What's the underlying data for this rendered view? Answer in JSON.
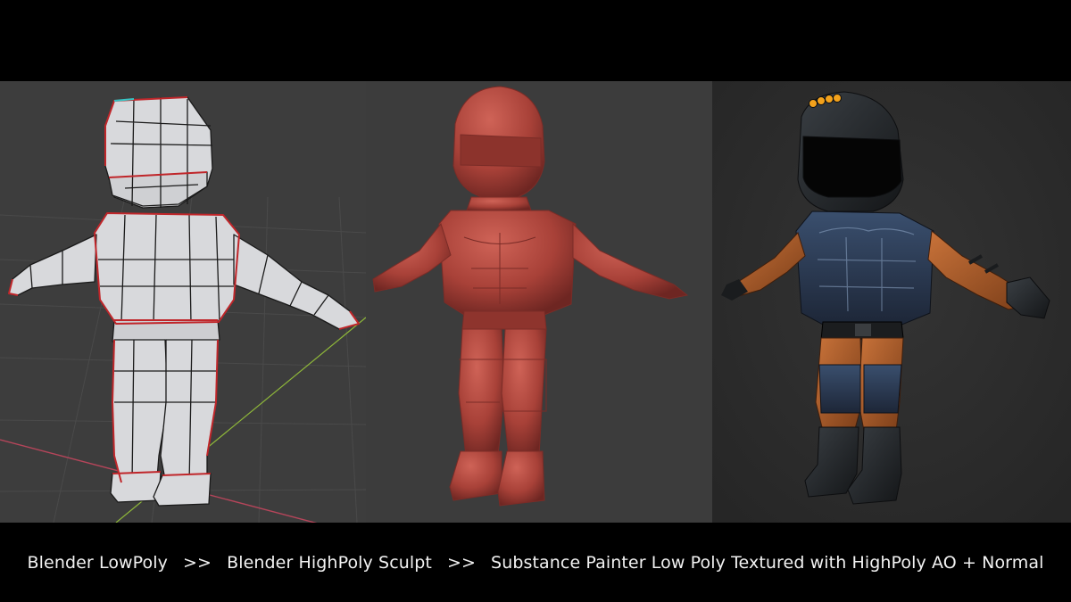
{
  "caption": {
    "step1": "Blender LowPoly",
    "sep1": ">>",
    "step2": "Blender HighPoly Sculpt",
    "sep2": ">>",
    "step3": "Substance Painter Low Poly Textured with HighPoly AO + Normal"
  },
  "colors": {
    "frame": "#000000",
    "viewport_bg": "#3f3f3f",
    "render_bg": "#2e2e2e",
    "lowpoly_mesh": "#d8d9dc",
    "lowpoly_wire": "#1a1a1a",
    "lowpoly_seam": "#c0262a",
    "sculpt_clay": "#b4483f",
    "textured_orange": "#b8642c",
    "textured_black": "#1c1f22",
    "helmet_lights": "#f3a21c",
    "axis_x": "#b5455a",
    "axis_y": "#8fb83a"
  },
  "icons": [
    "lowpoly-character-icon",
    "sculpt-character-icon",
    "textured-character-icon"
  ]
}
